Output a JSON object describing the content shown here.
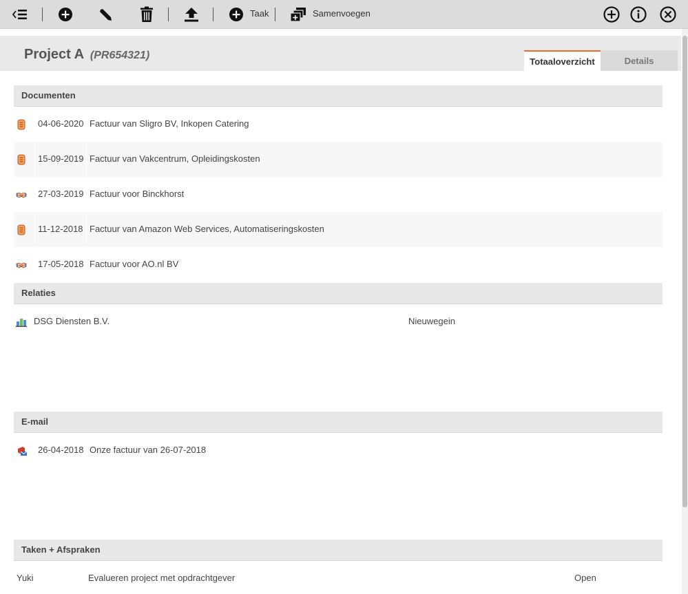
{
  "toolbar": {
    "taak_label": "Taak",
    "samenvoegen_label": "Samenvoegen"
  },
  "project": {
    "title": "Project A",
    "code": "(PR654321)"
  },
  "tabs": [
    {
      "label": "Totaaloverzicht",
      "active": true
    },
    {
      "label": "Details",
      "active": false
    }
  ],
  "sections": {
    "documenten": "Documenten",
    "relaties": "Relaties",
    "email": "E-mail",
    "taken": "Taken + Afspraken"
  },
  "documents": [
    {
      "date": "04-06-2020",
      "text": "Factuur van Sligro BV, Inkopen Catering",
      "icon": "receipt-icon"
    },
    {
      "date": "15-09-2019",
      "text": "Factuur van Vakcentrum, Opleidingskosten",
      "icon": "receipt-icon"
    },
    {
      "date": "27-03-2019",
      "text": "Factuur voor Binckhorst",
      "icon": "handshake-icon"
    },
    {
      "date": "11-12-2018",
      "text": "Factuur van Amazon Web Services, Automatiseringskosten",
      "icon": "receipt-icon"
    },
    {
      "date": "17-05-2018",
      "text": "Factuur voor AO.nl BV",
      "icon": "handshake-icon"
    }
  ],
  "relations": [
    {
      "name": "DSG Diensten B.V.",
      "city": "Nieuwegein",
      "icon": "company-icon"
    }
  ],
  "emails": [
    {
      "date": "26-04-2018",
      "text": "Onze factuur van 26-07-2018",
      "icon": "mail-icon"
    }
  ],
  "tasks": [
    {
      "who": "Yuki",
      "what": "Evalueren project met opdrachtgever",
      "status": "Open"
    }
  ],
  "colors": {
    "accent": "#e8702a",
    "toolbar_bg": "#dcdcdc",
    "section_bg": "#e8e8e8"
  }
}
